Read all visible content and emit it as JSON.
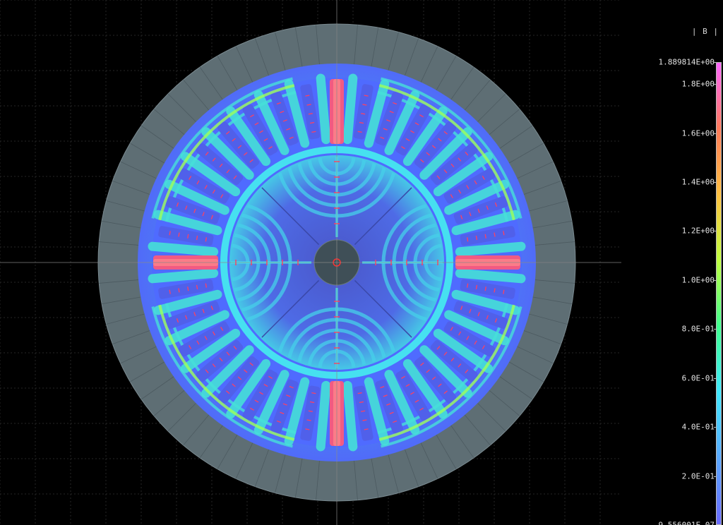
{
  "legend": {
    "title": "| B |",
    "labels": [
      "1.889814E+00",
      "1.8E+00",
      "1.6E+00",
      "1.4E+00",
      "1.2E+00",
      "1.0E+00",
      "8.0E-01",
      "6.0E-01",
      "4.0E-01",
      "2.0E-01",
      "9.556001E-07"
    ],
    "values": [
      1.889814,
      1.8,
      1.6,
      1.4,
      1.2,
      1.0,
      0.8,
      0.6,
      0.4,
      0.2,
      9.556001e-07
    ],
    "min": 9.556001e-07,
    "max": 1.889814,
    "gradient_colors": [
      "#ff66ff",
      "#ff7a5a",
      "#ffc040",
      "#c0ff40",
      "#40ff90",
      "#40e8ff",
      "#5aa8ff",
      "#6a6aff"
    ]
  },
  "colors": {
    "background": "#000000",
    "stator_outer": "#5e6e74",
    "grid": "#2a2a2a",
    "axis": "#8a8a8a",
    "low_field": "#4f6bff",
    "mid_field": "#37e0e8",
    "high_field": "#9dff5a",
    "peak_field": "#ff5070",
    "shaft": "#3f4f57"
  },
  "geometry_meta": {
    "stator_slots": 36,
    "rotor_poles": 4
  }
}
